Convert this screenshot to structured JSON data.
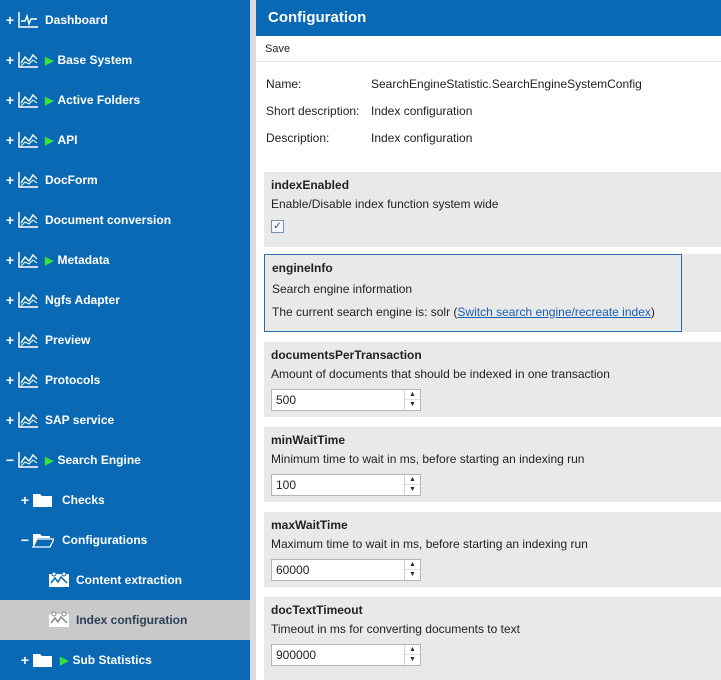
{
  "sidebar": {
    "items": [
      {
        "label": "Dashboard",
        "expander": "+",
        "icon": "dashboard-chart-icon",
        "arrow": false
      },
      {
        "label": "Base System",
        "expander": "+",
        "icon": "line-chart-icon",
        "arrow": true
      },
      {
        "label": "Active Folders",
        "expander": "+",
        "icon": "line-chart-icon",
        "arrow": true
      },
      {
        "label": "API",
        "expander": "+",
        "icon": "line-chart-icon",
        "arrow": true
      },
      {
        "label": "DocForm",
        "expander": "+",
        "icon": "line-chart-icon",
        "arrow": false
      },
      {
        "label": "Document conversion",
        "expander": "+",
        "icon": "line-chart-icon",
        "arrow": false
      },
      {
        "label": "Metadata",
        "expander": "+",
        "icon": "line-chart-icon",
        "arrow": true
      },
      {
        "label": "Ngfs Adapter",
        "expander": "+",
        "icon": "line-chart-icon",
        "arrow": false
      },
      {
        "label": "Preview",
        "expander": "+",
        "icon": "line-chart-icon",
        "arrow": false
      },
      {
        "label": "Protocols",
        "expander": "+",
        "icon": "line-chart-icon",
        "arrow": false
      },
      {
        "label": "SAP service",
        "expander": "+",
        "icon": "line-chart-icon",
        "arrow": false
      },
      {
        "label": "Search Engine",
        "expander": "−",
        "icon": "line-chart-icon",
        "arrow": true
      },
      {
        "label": "Checks",
        "expander": "+",
        "icon": "folder-icon",
        "arrow": false
      },
      {
        "label": "Configurations",
        "expander": "−",
        "icon": "folder-open-icon",
        "arrow": false
      },
      {
        "label": "Content extraction",
        "expander": "",
        "icon": "config-icon",
        "arrow": false
      },
      {
        "label": "Index configuration",
        "expander": "",
        "icon": "config-icon",
        "arrow": false,
        "selected": true
      },
      {
        "label": "Sub Statistics",
        "expander": "+",
        "icon": "folder-icon",
        "arrow": true
      }
    ]
  },
  "header": {
    "title": "Configuration"
  },
  "toolbar": {
    "save_label": "Save"
  },
  "meta": {
    "name_label": "Name:",
    "name_value": "SearchEngineStatistic.SearchEngineSystemConfig",
    "short_desc_label": "Short description:",
    "short_desc_value": "Index configuration",
    "desc_label": "Description:",
    "desc_value": "Index configuration"
  },
  "sections": {
    "indexEnabled": {
      "title": "indexEnabled",
      "desc": "Enable/Disable index function system wide",
      "checked": true
    },
    "engineInfo": {
      "title": "engineInfo",
      "desc": "Search engine information",
      "current_prefix": "The current search engine is: solr (",
      "link": "Switch search engine/recreate index",
      "current_suffix": ")"
    },
    "documentsPerTransaction": {
      "title": "documentsPerTransaction",
      "desc": "Amount of documents that should be indexed in one transaction",
      "value": "500"
    },
    "minWaitTime": {
      "title": "minWaitTime",
      "desc": "Minimum time to wait in ms, before starting an indexing run",
      "value": "100"
    },
    "maxWaitTime": {
      "title": "maxWaitTime",
      "desc": "Maximum time to wait in ms, before starting an indexing run",
      "value": "60000"
    },
    "docTextTimeout": {
      "title": "docTextTimeout",
      "desc": "Timeout in ms for converting documents to text",
      "value": "900000"
    }
  },
  "colors": {
    "sidebar_bg": "#0a69b4",
    "selected_bg": "#c9c9c9",
    "arrow": "#37e03a",
    "link": "#1a5fb4"
  }
}
